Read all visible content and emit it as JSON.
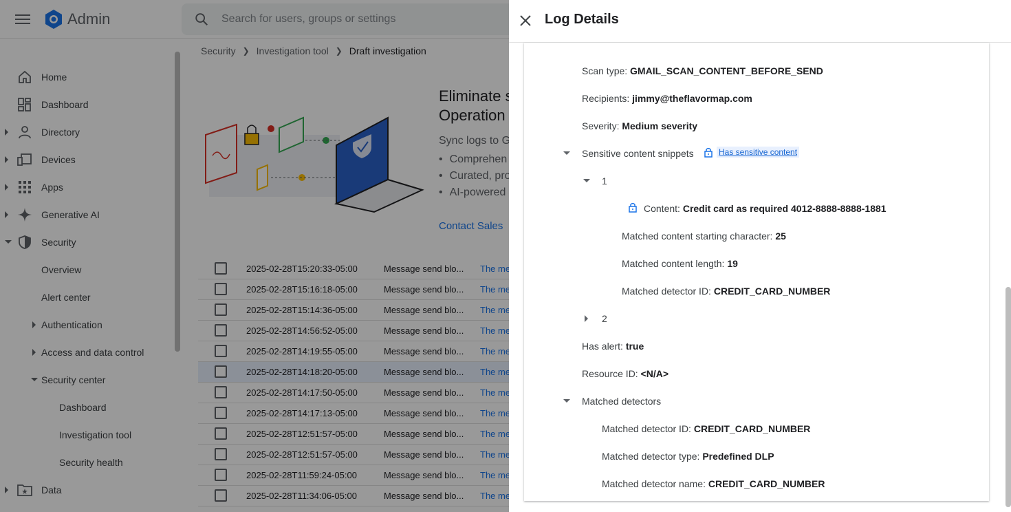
{
  "app": {
    "brand": "Admin",
    "search_placeholder": "Search for users, groups or settings"
  },
  "breadcrumb": [
    "Security",
    "Investigation tool",
    "Draft investigation"
  ],
  "sidebar": {
    "items": [
      {
        "label": "Home"
      },
      {
        "label": "Dashboard"
      },
      {
        "label": "Directory"
      },
      {
        "label": "Devices"
      },
      {
        "label": "Apps"
      },
      {
        "label": "Generative AI"
      },
      {
        "label": "Security"
      },
      {
        "label": "Overview"
      },
      {
        "label": "Alert center"
      },
      {
        "label": "Authentication"
      },
      {
        "label": "Access and data control"
      },
      {
        "label": "Security center"
      },
      {
        "label": "Dashboard"
      },
      {
        "label": "Investigation tool"
      },
      {
        "label": "Security health"
      },
      {
        "label": "Data"
      }
    ]
  },
  "banner": {
    "title_line1": "Eliminate s",
    "title_line2": "Operation",
    "subtitle": "Sync logs to G",
    "bullets": [
      "Comprehen",
      "Curated, pro",
      "AI-powered"
    ],
    "contact": "Contact Sales"
  },
  "table": {
    "rows": [
      {
        "ts": "2025-02-28T15:20:33-05:00",
        "event": "Message send blo...",
        "desc": "The me"
      },
      {
        "ts": "2025-02-28T15:16:18-05:00",
        "event": "Message send blo...",
        "desc": "The me"
      },
      {
        "ts": "2025-02-28T15:14:36-05:00",
        "event": "Message send blo...",
        "desc": "The me"
      },
      {
        "ts": "2025-02-28T14:56:52-05:00",
        "event": "Message send blo...",
        "desc": "The me"
      },
      {
        "ts": "2025-02-28T14:19:55-05:00",
        "event": "Message send blo...",
        "desc": "The me"
      },
      {
        "ts": "2025-02-28T14:18:20-05:00",
        "event": "Message send blo...",
        "desc": "The me"
      },
      {
        "ts": "2025-02-28T14:17:50-05:00",
        "event": "Message send blo...",
        "desc": "The me"
      },
      {
        "ts": "2025-02-28T14:17:13-05:00",
        "event": "Message send blo...",
        "desc": "The me"
      },
      {
        "ts": "2025-02-28T12:51:57-05:00",
        "event": "Message send blo...",
        "desc": "The me"
      },
      {
        "ts": "2025-02-28T12:51:57-05:00",
        "event": "Message send blo...",
        "desc": "The me"
      },
      {
        "ts": "2025-02-28T11:59:24-05:00",
        "event": "Message send blo...",
        "desc": "The me"
      },
      {
        "ts": "2025-02-28T11:34:06-05:00",
        "event": "Message send blo...",
        "desc": "The me"
      }
    ]
  },
  "drawer": {
    "title": "Log Details",
    "scan_type": {
      "key": "Scan type:",
      "value": "GMAIL_SCAN_CONTENT_BEFORE_SEND"
    },
    "recipients": {
      "key": "Recipients:",
      "value": "jimmy@theflavormap.com"
    },
    "severity": {
      "key": "Severity:",
      "value": "Medium severity"
    },
    "snippets": {
      "label": "Sensitive content snippets",
      "chip": "Has sensitive content",
      "item1": "1",
      "item2": "2",
      "content": {
        "key": "Content:",
        "value": "Credit card as required 4012-8888-8888-1881"
      },
      "start": {
        "key": "Matched content starting character:",
        "value": "25"
      },
      "length": {
        "key": "Matched content length:",
        "value": "19"
      },
      "detector": {
        "key": "Matched detector ID:",
        "value": "CREDIT_CARD_NUMBER"
      }
    },
    "has_alert": {
      "key": "Has alert:",
      "value": "true"
    },
    "resource_id": {
      "key": "Resource ID:",
      "value": "<N/A>"
    },
    "matched": {
      "label": "Matched detectors",
      "id": {
        "key": "Matched detector ID:",
        "value": "CREDIT_CARD_NUMBER"
      },
      "type": {
        "key": "Matched detector type:",
        "value": "Predefined DLP"
      },
      "name": {
        "key": "Matched detector name:",
        "value": "CREDIT_CARD_NUMBER"
      }
    }
  },
  "colors": {
    "accent": "#1a73e8",
    "chip_bg": "#e8f0fe",
    "scrim": "#000000"
  }
}
